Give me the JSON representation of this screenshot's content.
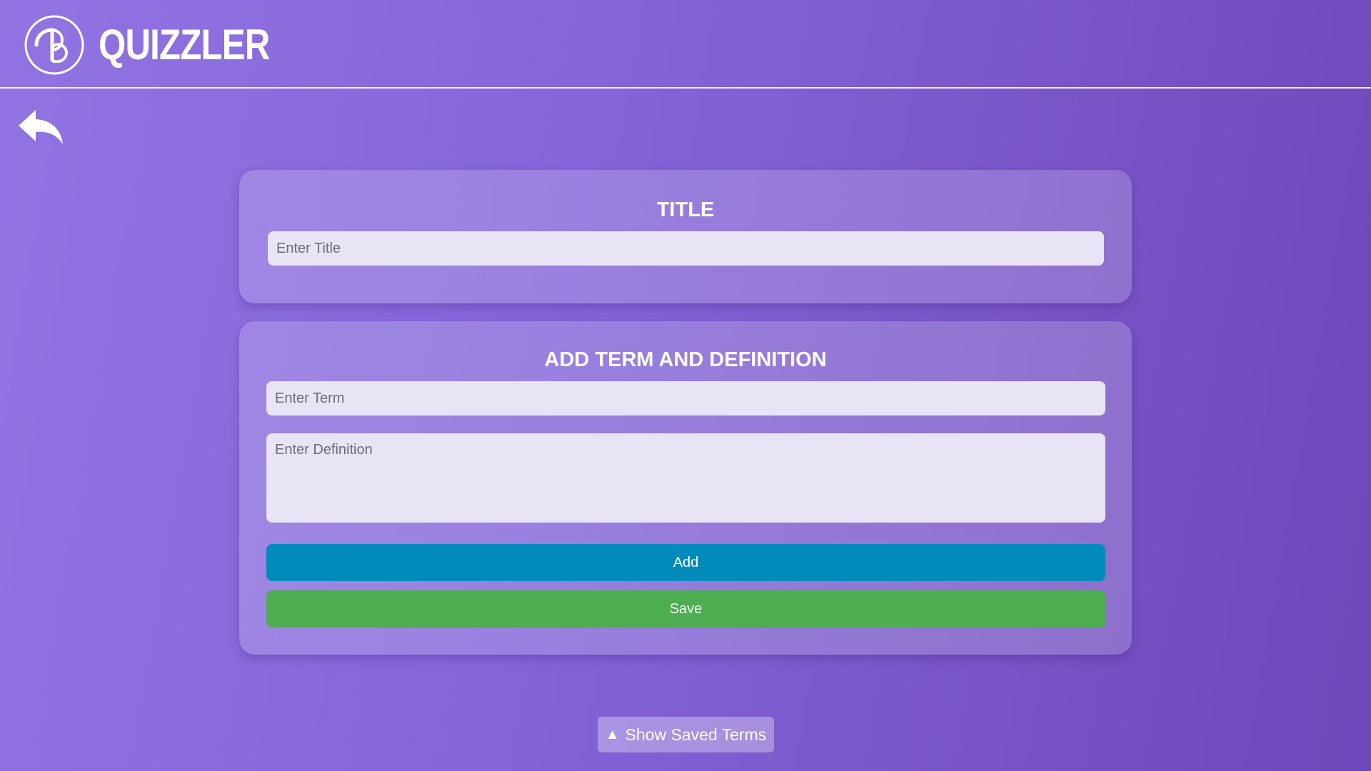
{
  "app": {
    "brand": "QUIZZLER",
    "logo_icon": "logo-icon",
    "back_icon": "back-arrow-icon"
  },
  "title_section": {
    "heading": "TITLE",
    "title_placeholder": "Enter Title",
    "title_value": ""
  },
  "term_section": {
    "heading": "ADD TERM AND DEFINITION",
    "term_placeholder": "Enter Term",
    "term_value": "",
    "definition_placeholder": "Enter Definition",
    "definition_value": "",
    "add_label": "Add",
    "save_label": "Save"
  },
  "footer": {
    "show_saved_label": "Show Saved Terms",
    "show_saved_icon": "triangle-up-icon"
  },
  "colors": {
    "add_button": "#008bbb",
    "save_button": "#4cae50",
    "background_start": "#9173e2",
    "background_end": "#6e47b9"
  }
}
